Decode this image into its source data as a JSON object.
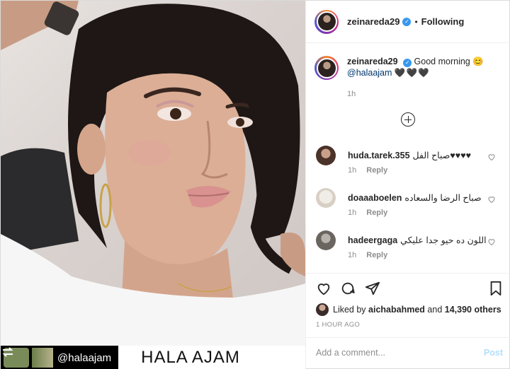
{
  "post": {
    "username": "zeinareda29",
    "verified_glyph": "✓",
    "follow_separator": "•",
    "follow_status": "Following",
    "caption": {
      "text": "Good morning 😊",
      "mention": "@halaajam",
      "hearts": "🖤🖤🖤",
      "time": "1h"
    },
    "more_comments_icon": "plus-circle-icon"
  },
  "comments": [
    {
      "user": "huda.tarek.355",
      "text": "صباح الفل♥♥♥♥",
      "time": "1h",
      "reply": "Reply"
    },
    {
      "user": "doaaaboelen",
      "text": "صباح الرضا والسعاده",
      "time": "1h",
      "reply": "Reply"
    },
    {
      "user": "hadeergaga",
      "text": "اللون ده حيو جدا عليكي",
      "time": "1h",
      "reply": "Reply"
    }
  ],
  "likes": {
    "prefix": "Liked by",
    "user": "aichabahmed",
    "and": "and",
    "count": "14,390 others"
  },
  "posted_ago": "1 HOUR AGO",
  "add_comment": {
    "placeholder": "Add a comment...",
    "post_label": "Post"
  },
  "photo": {
    "watermark_handle": "@halaajam",
    "watermark_name": "HALA AJAM"
  },
  "colors": {
    "link": "#00376b",
    "verified": "#3897f0",
    "post_disabled": "#b2dffc",
    "muted": "#8e8e8e"
  }
}
